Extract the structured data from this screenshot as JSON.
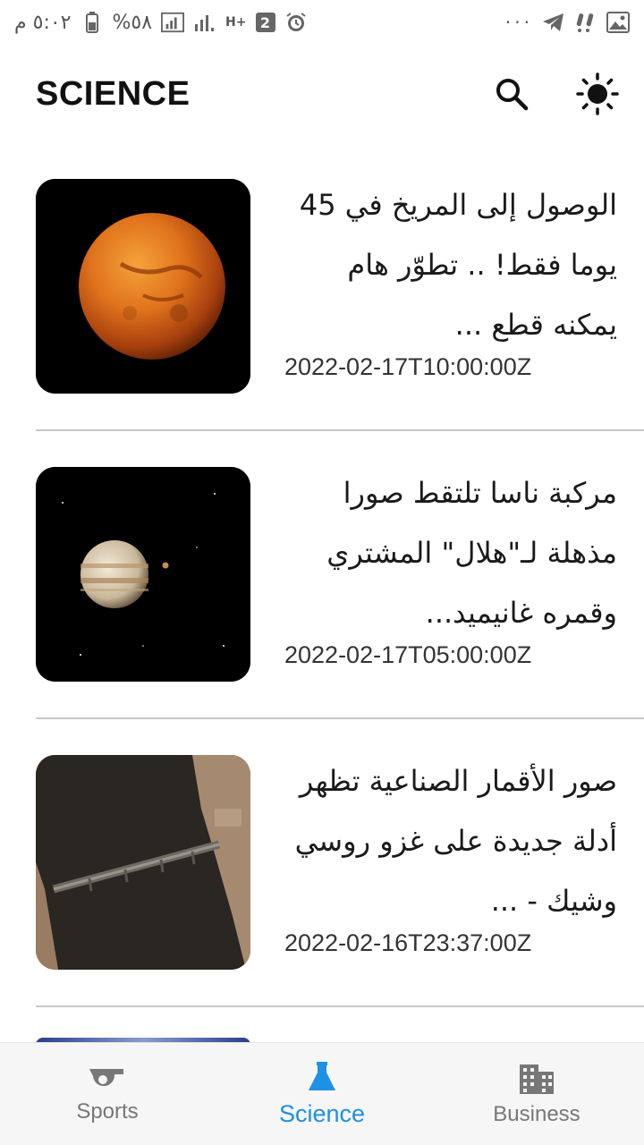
{
  "status_bar": {
    "time": "٥:٠٢ م",
    "battery": "%٥٨",
    "network": "H+",
    "sim_badge": "2",
    "more": "···"
  },
  "app_bar": {
    "title": "SCIENCE",
    "search_icon": "search-icon",
    "theme_icon": "brightness-icon"
  },
  "articles": [
    {
      "title": "الوصول إلى المريخ في 45 يوما فقط! .. تطوّر هام يمكنه قطع ...",
      "date": "2022-02-17T10:00:00Z",
      "thumbnail": "mars"
    },
    {
      "title": "مركبة ناسا تلتقط صورا مذهلة لـ\"هلال\" المشتري وقمره غانيميد...",
      "date": "2022-02-17T05:00:00Z",
      "thumbnail": "jupiter"
    },
    {
      "title": "صور الأقمار الصناعية تظهر أدلة جديدة على غزو روسي وشيك - ...",
      "date": "2022-02-16T23:37:00Z",
      "thumbnail": "satellite-bridge"
    }
  ],
  "bottom_nav": {
    "items": [
      {
        "label": "Sports",
        "icon": "whistle-icon",
        "active": false
      },
      {
        "label": "Science",
        "icon": "flask-icon",
        "active": true
      },
      {
        "label": "Business",
        "icon": "building-icon",
        "active": false
      }
    ],
    "active_color": "#1e90e6",
    "inactive_color": "#777777"
  }
}
